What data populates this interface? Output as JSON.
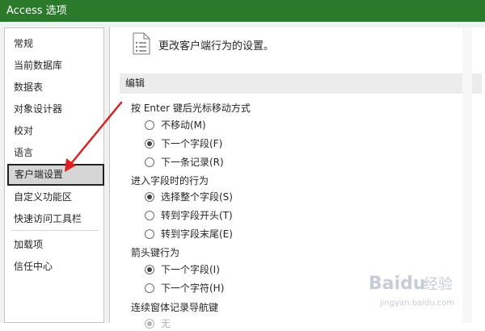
{
  "window": {
    "title": "Access 选项"
  },
  "sidebar": {
    "items": [
      {
        "label": "常规"
      },
      {
        "label": "当前数据库"
      },
      {
        "label": "数据表"
      },
      {
        "label": "对象设计器"
      },
      {
        "label": "校对"
      },
      {
        "label": "语言"
      },
      {
        "label": "客户端设置",
        "selected": true
      },
      {
        "label": "自定义功能区"
      },
      {
        "label": "快速访问工具栏"
      },
      {
        "label": "加载项"
      },
      {
        "label": "信任中心"
      }
    ]
  },
  "main": {
    "header_icon": "document-settings-icon",
    "header_text": "更改客户端行为的设置。",
    "section_title": "编辑",
    "groups": [
      {
        "label": "按 Enter 键后光标移动方式",
        "options": [
          {
            "label": "不移动(M)",
            "checked": false
          },
          {
            "label": "下一个字段(F)",
            "checked": true
          },
          {
            "label": "下一条记录(R)",
            "checked": false
          }
        ]
      },
      {
        "label": "进入字段时的行为",
        "options": [
          {
            "label": "选择整个字段(S)",
            "checked": true
          },
          {
            "label": "转到字段开头(T)",
            "checked": false
          },
          {
            "label": "转到字段末尾(E)",
            "checked": false
          }
        ]
      },
      {
        "label": "箭头键行为",
        "options": [
          {
            "label": "下一个字段(I)",
            "checked": true
          },
          {
            "label": "下一个字符(H)",
            "checked": false
          }
        ]
      },
      {
        "label": "连续窗体记录导航键",
        "options": [
          {
            "label": "无",
            "checked": true,
            "disabled": true
          }
        ]
      }
    ]
  },
  "watermark": {
    "brand": "Baidu",
    "tagline": "经验",
    "url": "jingyan.baidu.com"
  },
  "colors": {
    "titlebar": "#2b7a2b",
    "annotation_arrow": "#e02020",
    "window_bg": "#f1f1f1",
    "selected_item_bg": "#d6d6d6"
  }
}
